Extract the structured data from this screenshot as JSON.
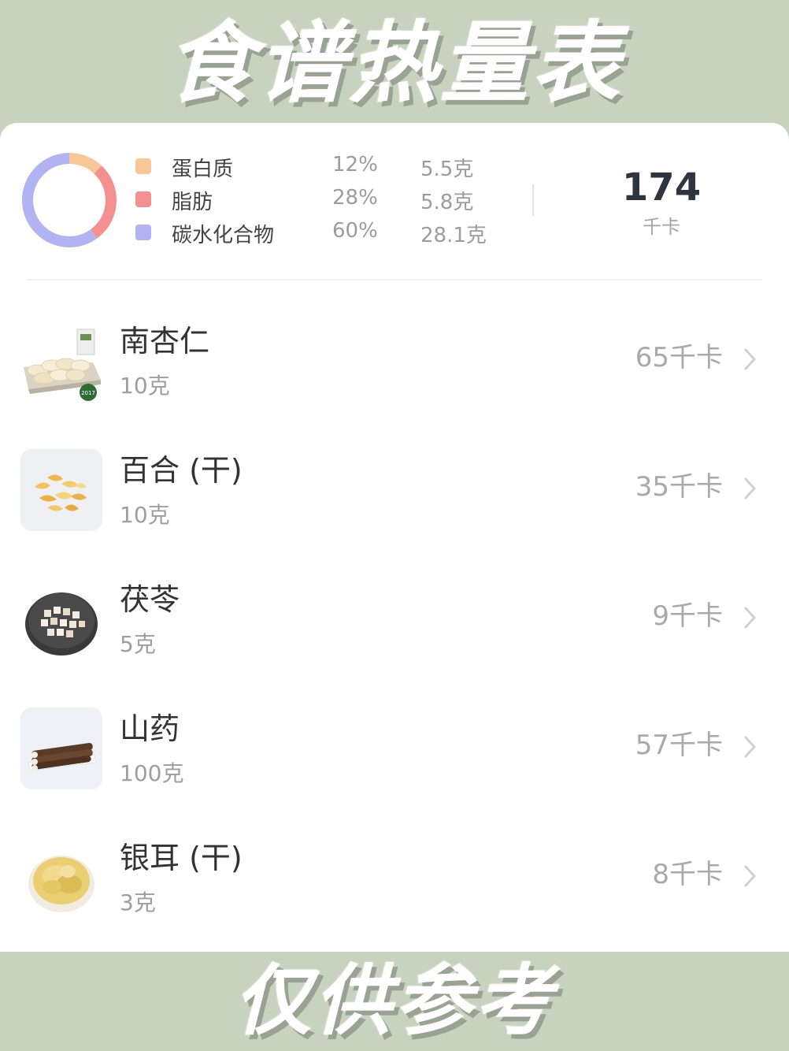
{
  "banner": {
    "top_title": "食谱热量表",
    "bottom_title": "仅供参考"
  },
  "summary": {
    "nutrients": [
      {
        "name": "蛋白质",
        "percent": "12%",
        "amount": "5.5克",
        "color": "#f9c695",
        "fraction": 0.12
      },
      {
        "name": "脂肪",
        "percent": "28%",
        "amount": "5.8克",
        "color": "#f48f8f",
        "fraction": 0.28
      },
      {
        "name": "碳水化合物",
        "percent": "60%",
        "amount": "28.1克",
        "color": "#b2b3f3",
        "fraction": 0.6
      }
    ],
    "total_kcal": "174",
    "total_unit": "千卡"
  },
  "foods": [
    {
      "name": "南杏仁",
      "amount": "10克",
      "kcal": "65千卡",
      "icon": "almond-image"
    },
    {
      "name": "百合 (干)",
      "amount": "10克",
      "kcal": "35千卡",
      "icon": "dried-lily-image"
    },
    {
      "name": "茯苓",
      "amount": "5克",
      "kcal": "9千卡",
      "icon": "poria-image"
    },
    {
      "name": "山药",
      "amount": "100克",
      "kcal": "57千卡",
      "icon": "yam-image"
    },
    {
      "name": "银耳 (干)",
      "amount": "3克",
      "kcal": "8千卡",
      "icon": "white-fungus-image"
    }
  ]
}
